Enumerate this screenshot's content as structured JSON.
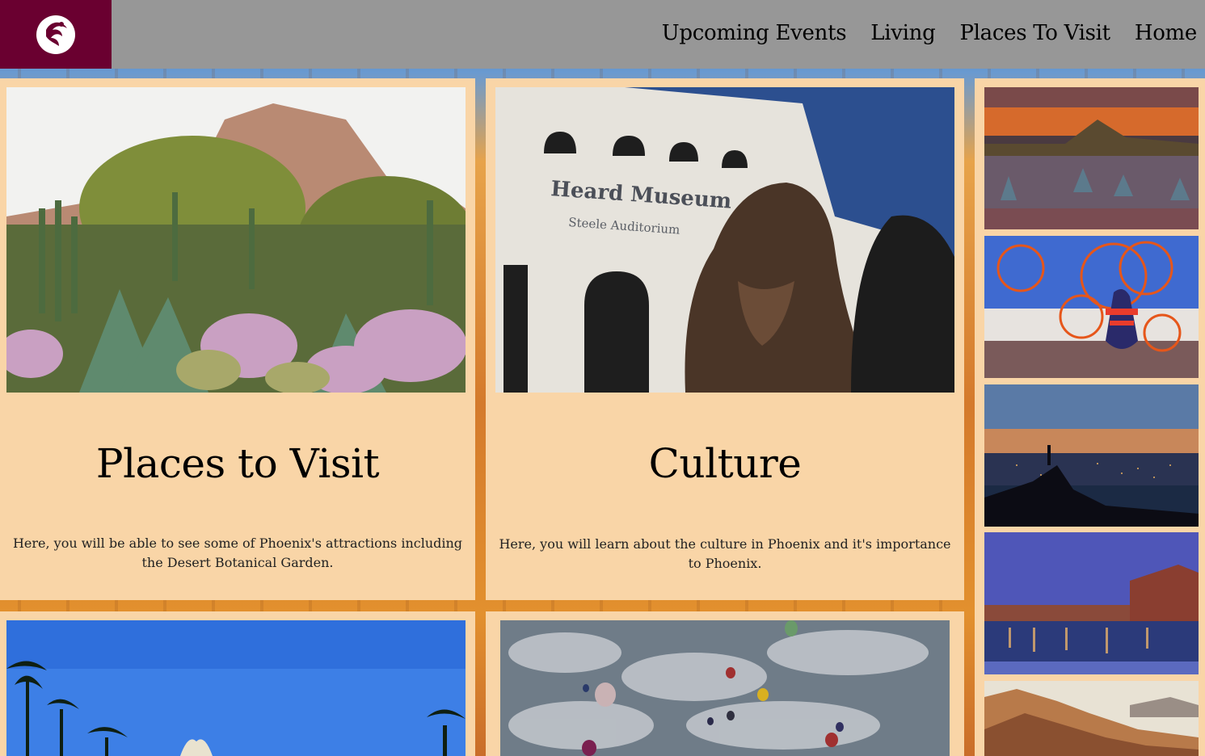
{
  "logo": {
    "icon": "phoenix-bird-icon",
    "brand_color": "#6a0030"
  },
  "nav": {
    "items": [
      {
        "label": "Upcoming Events"
      },
      {
        "label": "Living"
      },
      {
        "label": "Places To Visit"
      },
      {
        "label": "Home"
      }
    ]
  },
  "cards": [
    {
      "title": "Places to Visit",
      "text": "Here, you will be able to see some of Phoenix's attractions including the Desert Botanical Garden.",
      "image": "desert-botanical-garden-photo"
    },
    {
      "title": "Culture",
      "text": "Here, you will learn about the culture in Phoenix and it's importance to Phoenix.",
      "image": "heard-museum-photo",
      "image_sign": "Heard Museum",
      "image_subsign": "Steele Auditorium"
    },
    {
      "image": "palm-trees-photo"
    },
    {
      "image": "hot-air-balloons-photo"
    }
  ],
  "sidebar": {
    "thumbs": [
      {
        "image": "desert-sunset-photo"
      },
      {
        "image": "hoop-dancer-photo"
      },
      {
        "image": "city-lights-hiker-photo"
      },
      {
        "image": "taliesin-pool-photo"
      },
      {
        "image": "red-rock-mountain-photo"
      }
    ]
  },
  "colors": {
    "header": "#979797",
    "card": "#f9d5a7",
    "brand": "#6a0030"
  }
}
